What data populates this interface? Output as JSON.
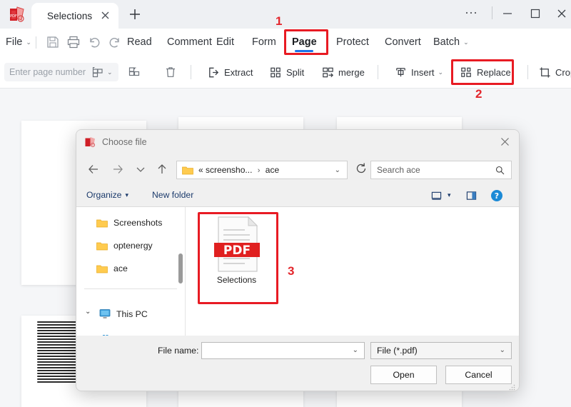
{
  "window": {
    "app_icon": "pdf-app-icon",
    "tab_label": "Selections",
    "tab_close_icon": "close-icon",
    "new_tab_icon": "plus-icon",
    "more_icon": "···",
    "minimize_icon": "minimize-icon",
    "maximize_icon": "maximize-icon",
    "close_icon": "close-icon"
  },
  "ribbon": {
    "file_label": "File",
    "file_chevron": "⌄",
    "save_icon": "save-icon",
    "print_icon": "print-icon",
    "undo_icon": "undo-icon",
    "redo_icon": "redo-icon",
    "items": [
      {
        "label": "Read",
        "active": false
      },
      {
        "label": "Comment",
        "active": false
      },
      {
        "label": "Edit",
        "active": false
      },
      {
        "label": "Form",
        "active": false
      },
      {
        "label": "Page",
        "active": true
      },
      {
        "label": "Protect",
        "active": false
      },
      {
        "label": "Convert",
        "active": false
      },
      {
        "label": "Batch",
        "active": false
      }
    ],
    "batch_chevron": "⌄"
  },
  "toolbar": {
    "page_number_placeholder": "Enter page number",
    "page_layout_icon": "page-layout-icon",
    "layout_chevron": "⌄",
    "insert_pages_icon": "insert-pages-icon",
    "delete_icon": "trash-icon",
    "extract_label": "Extract",
    "extract_icon": "extract-icon",
    "split_label": "Split",
    "split_icon": "split-icon",
    "merge_label": "merge",
    "merge_icon": "merge-icon",
    "insert_label": "Insert",
    "insert_icon": "insert-icon",
    "insert_chevron": "⌄",
    "replace_label": "Replace",
    "replace_icon": "replace-icon",
    "crop_label": "Crop",
    "crop_icon": "crop-icon"
  },
  "annotations": {
    "step1": "1",
    "step2": "2",
    "step3": "3"
  },
  "dialog": {
    "title": "Choose file",
    "title_icon": "pdf-app-icon",
    "close_icon": "close-icon",
    "nav": {
      "back_icon": "arrow-left-icon",
      "forward_icon": "arrow-right-icon",
      "recent_chevron_icon": "chevron-down-icon",
      "up_icon": "arrow-up-icon",
      "folder_icon": "folder-icon",
      "breadcrumb_prefix": "«",
      "breadcrumb_parent": "screensho...",
      "breadcrumb_sep": "›",
      "breadcrumb_current": "ace",
      "address_chevron": "⌄",
      "refresh_icon": "refresh-icon",
      "search_placeholder": "Search ace",
      "search_icon": "search-icon"
    },
    "commands": {
      "organize_label": "Organize",
      "organize_caret": "▾",
      "new_folder_label": "New folder",
      "view_icon": "view-icon",
      "view_caret": "▾",
      "pane_icon": "preview-pane-icon",
      "help_icon": "help-icon"
    },
    "sidebar": {
      "items": [
        {
          "label": "Screenshots",
          "icon": "folder-icon"
        },
        {
          "label": "optenergy",
          "icon": "folder-icon"
        },
        {
          "label": "ace",
          "icon": "folder-icon"
        }
      ],
      "this_pc_label": "This PC",
      "this_pc_icon": "monitor-icon",
      "this_pc_chevron": "⌄"
    },
    "files": [
      {
        "name": "Selections",
        "icon": "pdf-file-icon",
        "badge": "PDF",
        "selected": true
      }
    ],
    "footer": {
      "file_name_label": "File name:",
      "file_name_value": "",
      "file_name_chevron": "⌄",
      "file_type_value": "File (*.pdf)",
      "file_type_chevron": "⌄",
      "open_label": "Open",
      "cancel_label": "Cancel"
    }
  },
  "colors": {
    "accent_red": "#e81b23",
    "tab_underline_blue": "#1a73e8",
    "pdf_red": "#e02020",
    "folder_yellow": "#ffd04a",
    "link_blue": "#1b3a6b"
  }
}
